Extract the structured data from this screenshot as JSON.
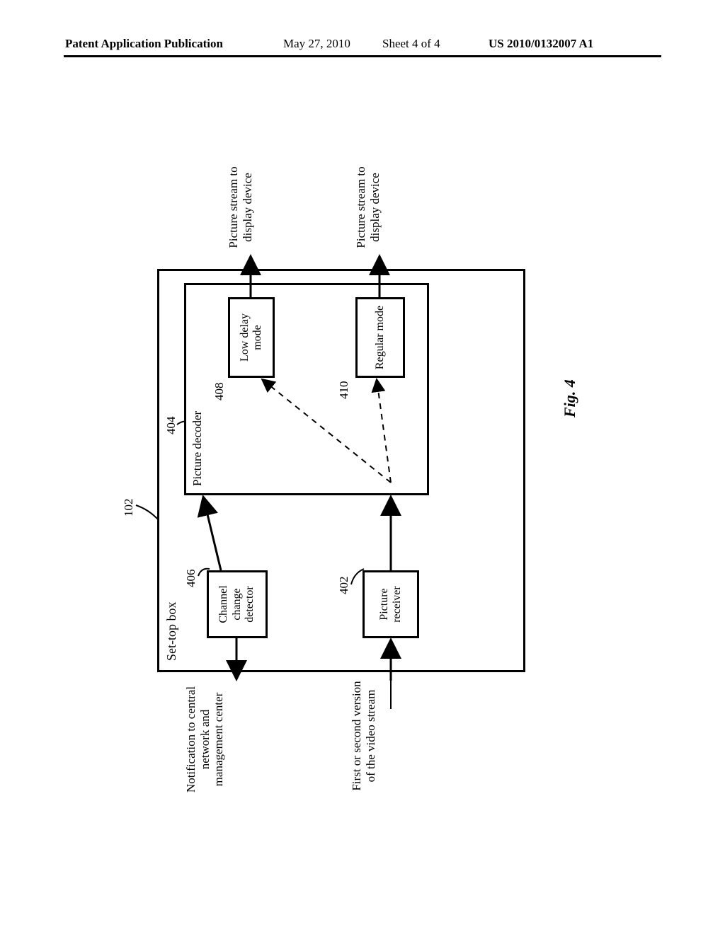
{
  "header": {
    "left": "Patent Application Publication",
    "date": "May 27, 2010",
    "sheet": "Sheet 4 of 4",
    "pubno": "US 2010/0132007 A1"
  },
  "figure_label": "Fig. 4",
  "refs": {
    "stb": "102",
    "ccd": "406",
    "prx": "402",
    "pdec": "404",
    "ldm": "408",
    "rgm": "410"
  },
  "boxes": {
    "stb": "Set-top box",
    "ccd": "Channel change detector",
    "prx": "Picture receiver",
    "pdec": "Picture decoder",
    "ldm": "Low delay mode",
    "rgm": "Regular mode"
  },
  "external": {
    "notification": "Notification to central network and management center",
    "video_in": "First or second version of the video stream",
    "out1": "Picture stream to display device",
    "out2": "Picture stream to display device"
  }
}
